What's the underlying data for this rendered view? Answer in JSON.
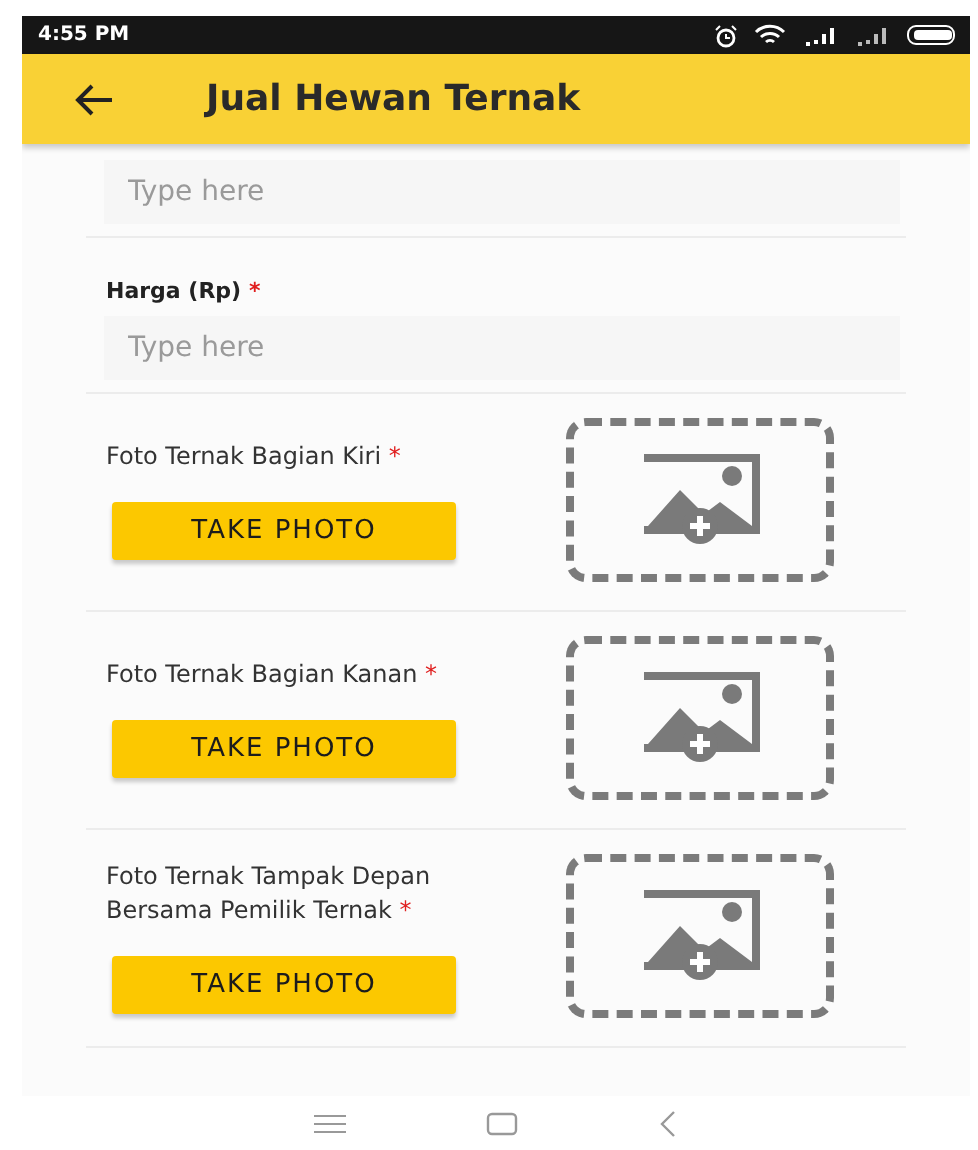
{
  "status_bar": {
    "time": "4:55 PM"
  },
  "app_bar": {
    "title": "Jual Hewan Ternak"
  },
  "fields": [
    {
      "placeholder": "Type here"
    },
    {
      "label": "Harga (Rp)",
      "required_mark": "*",
      "placeholder": "Type here"
    }
  ],
  "photos": [
    {
      "label": "Foto Ternak Bagian Kiri",
      "required_mark": "*",
      "button": "TAKE PHOTO"
    },
    {
      "label": "Foto Ternak Bagian Kanan",
      "required_mark": "*",
      "button": "TAKE PHOTO"
    },
    {
      "label": "Foto Ternak Tampak Depan Bersama Pemilik Ternak",
      "required_mark": "*",
      "button": "TAKE PHOTO"
    }
  ]
}
